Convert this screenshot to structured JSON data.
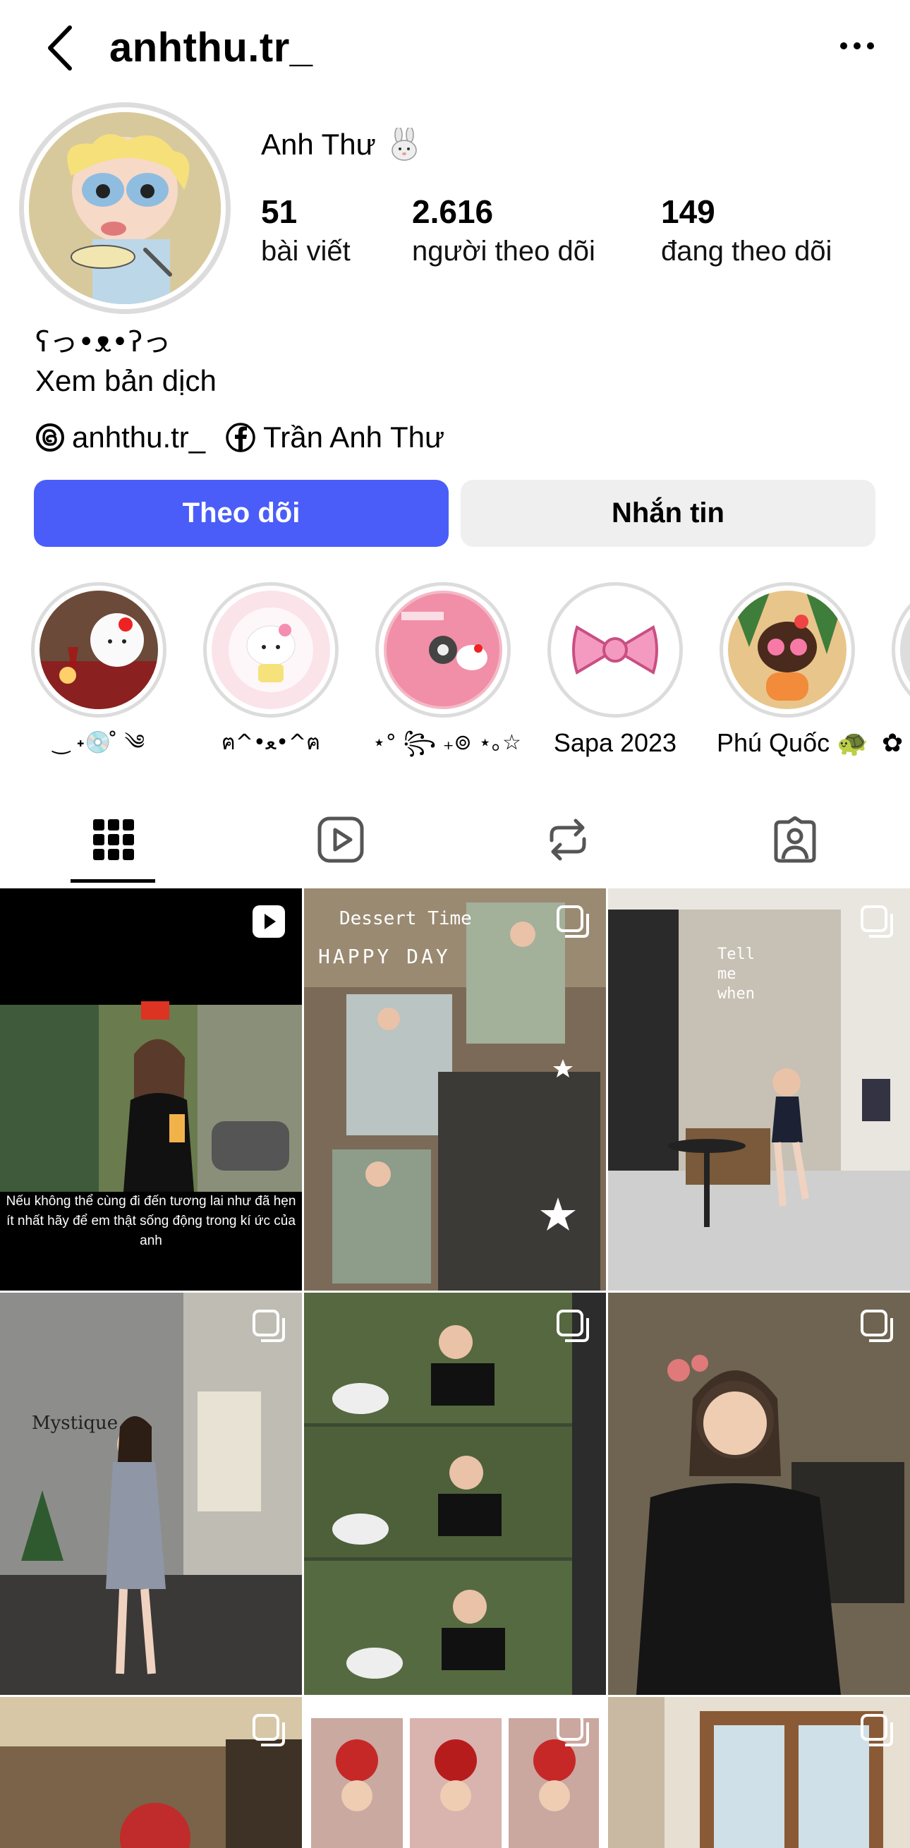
{
  "header": {
    "username": "anhthu.tr_"
  },
  "profile": {
    "display_name": "Anh Thư",
    "stats": [
      {
        "value": "51",
        "label": "bài viết"
      },
      {
        "value": "2.616",
        "label": "người theo dõi"
      },
      {
        "value": "149",
        "label": "đang theo dõi"
      }
    ],
    "bio": "ʕっ•ᴥ•ʔっ",
    "translate_label": "Xem bản dịch",
    "threads_handle": "anhthu.tr_",
    "facebook_name": "Trần Anh Thư"
  },
  "actions": {
    "follow_label": "Theo dõi",
    "message_label": "Nhắn tin"
  },
  "highlights": [
    {
      "label": "‿ ˖💿 ̊ ༄"
    },
    {
      "label": "ฅ^•ﻌ•^ฅ"
    },
    {
      "label": "⋆° ꧂ ₊⊚ ⋆｡☆"
    },
    {
      "label": "Sapa 2023"
    },
    {
      "label": "Phú Quốc 🐢"
    },
    {
      "label": "✿"
    }
  ],
  "tabs": [
    "posts-grid",
    "reels",
    "reposts",
    "tagged"
  ],
  "posts": [
    {
      "type": "reel",
      "caption_line1": "Nếu không thể cùng đi đến tương lai như đã hẹn",
      "caption_line2": "ít nhất hãy để em thật sống động trong kí ức của anh"
    },
    {
      "type": "carousel",
      "overlay_text1": "Dessert Time",
      "overlay_text2": "HAPPY DAY"
    },
    {
      "type": "carousel",
      "overlay_text1": "Tell me when"
    },
    {
      "type": "carousel",
      "sign_text": "Mystique"
    },
    {
      "type": "carousel"
    },
    {
      "type": "carousel"
    },
    {
      "type": "carousel"
    },
    {
      "type": "carousel"
    },
    {
      "type": "carousel"
    }
  ],
  "colors": {
    "follow_button": "#4a5df9",
    "message_button": "#efefef"
  }
}
